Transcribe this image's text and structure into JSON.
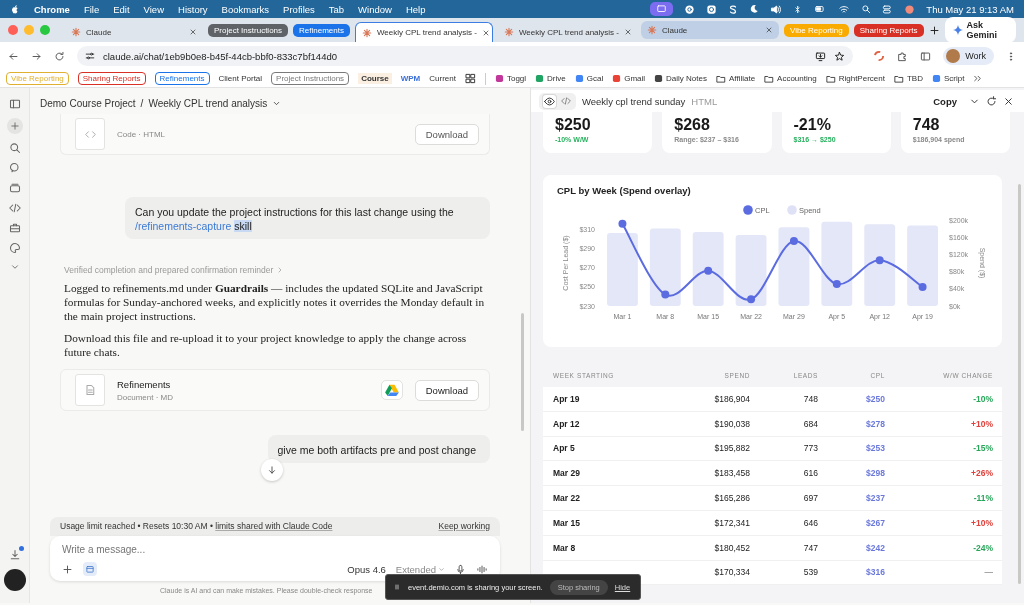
{
  "menu_bar": {
    "app": "Chrome",
    "items": [
      "File",
      "Edit",
      "View",
      "History",
      "Bookmarks",
      "Profiles",
      "Tab",
      "Window",
      "Help"
    ],
    "clock": "Thu May 21  9:13 AM"
  },
  "tabs": [
    {
      "kind": "tab",
      "label": "Claude",
      "selected": false,
      "hovered": false
    },
    {
      "kind": "group",
      "label": "Project Instructions",
      "color": "#5f6368"
    },
    {
      "kind": "group",
      "label": "Refinements",
      "color": "#1a73e8"
    },
    {
      "kind": "tab",
      "label": "Weekly CPL trend analysis -",
      "selected": true,
      "hovered": false
    },
    {
      "kind": "tab",
      "label": "Weekly CPL trend analysis -",
      "selected": false,
      "hovered": false
    },
    {
      "kind": "tab",
      "label": "Claude",
      "selected": false,
      "hovered": true
    },
    {
      "kind": "group",
      "label": "Vibe Reporting",
      "color": "#f9ab00"
    },
    {
      "kind": "group",
      "label": "Sharing Reports",
      "color": "#d93025"
    }
  ],
  "gemini_button": "Ask Gemini",
  "address_bar": {
    "url": "claude.ai/chat/1eb9b0e8-b45f-44cb-bbf0-833c7bf144d0"
  },
  "profile": "Work",
  "bookmarks": [
    {
      "kind": "group",
      "label": "Vibe Reporting",
      "color": "#e0b030"
    },
    {
      "kind": "group",
      "label": "Sharing Reports",
      "color": "#d93025"
    },
    {
      "kind": "group",
      "label": "Refinements",
      "color": "#1a73e8"
    },
    {
      "kind": "text",
      "label": "Client Portal"
    },
    {
      "kind": "group",
      "label": "Project Instructions",
      "color": "#7a7a7a"
    },
    {
      "kind": "text",
      "label": "Course"
    },
    {
      "kind": "text",
      "label": "WPM"
    },
    {
      "kind": "text",
      "label": "Current"
    },
    {
      "kind": "apps"
    },
    {
      "kind": "site",
      "label": "Toggl",
      "color": "#c2379a"
    },
    {
      "kind": "site",
      "label": "Drive",
      "color": "#1fa463"
    },
    {
      "kind": "site",
      "label": "Gcal",
      "color": "#4285f4"
    },
    {
      "kind": "site",
      "label": "Gmail",
      "color": "#ea4335"
    },
    {
      "kind": "site",
      "label": "Daily Notes",
      "color": "#444444"
    },
    {
      "kind": "folder",
      "label": "Affiliate"
    },
    {
      "kind": "folder",
      "label": "Accounting"
    },
    {
      "kind": "folder",
      "label": "RightPercent"
    },
    {
      "kind": "folder",
      "label": "TBD"
    },
    {
      "kind": "site",
      "label": "Script",
      "color": "#4285f4"
    }
  ],
  "chat": {
    "breadcrumb": [
      "Demo Course Project",
      "/",
      "Weekly CPL trend analysis"
    ],
    "artifact_card": {
      "meta": "Code · HTML",
      "button": "Download"
    },
    "messages": [
      {
        "kind": "user",
        "parts": [
          {
            "kind": "text",
            "text": "Can you update the project instructions for this last change using the",
            "highlighted": false
          },
          {
            "kind": "command",
            "text": "/refinements-capture",
            "highlighted": false
          },
          {
            "kind": "text",
            "text": "skill",
            "highlighted": true
          }
        ]
      },
      {
        "kind": "assistant",
        "summary": "Verified completion and prepared confirmation reminder",
        "paragraphs": [
          "Logged to refinements.md under **Guardrails** — includes the updated SQLite and JavaScript formulas for Sunday-anchored weeks, and explicitly notes it overrides the Monday default in the main project instructions.",
          "Download this file and re-upload it to your project knowledge to apply the change across future chats."
        ],
        "file": {
          "title": "Refinements",
          "meta": "Document · MD",
          "button": "Download"
        }
      },
      {
        "kind": "user",
        "parts": [
          {
            "kind": "text",
            "text": "give me both artifacts pre and post change",
            "highlighted": false
          }
        ]
      }
    ],
    "usage": {
      "text": "Usage limit reached • Resets 10:30 AM •",
      "link": "limits shared with Claude Code",
      "action": "Keep working"
    },
    "composer": {
      "placeholder": "Write a message...",
      "model": "Opus 4.6",
      "mode": "Extended"
    },
    "disclaimer": "Claude is AI and can make mistakes. Please double-check response"
  },
  "artifact": {
    "view_toggle": {
      "preview": true
    },
    "title": "Weekly cpl trend sunday",
    "type": "HTML",
    "copy": "Copy",
    "stats": [
      {
        "value": "$250",
        "sub": "-10% W/W",
        "color": "#27b05e"
      },
      {
        "value": "$268",
        "sub": "Range: $237 – $316",
        "color": "#8a8a8a"
      },
      {
        "value": "-21%",
        "sub": "$316 → $250",
        "color": "#27b05e"
      },
      {
        "value": "748",
        "sub": "$186,904 spend",
        "color": "#8a8a8a"
      }
    ],
    "chart_data": {
      "type": "bar",
      "legend": "top",
      "title": "CPL by Week (Spend overlay)",
      "ylabel": "Cost Per Lead ($)",
      "y2label": "Spend ($)",
      "categories": [
        "Mar 1",
        "Mar 8",
        "Mar 15",
        "Mar 22",
        "Mar 29",
        "Apr 5",
        "Apr 12",
        "Apr 19"
      ],
      "series": [
        {
          "name": "CPL",
          "type": "line",
          "marker": "circle",
          "color": "#5b6be0",
          "values": [
            316,
            242,
            267,
            237,
            298,
            253,
            278,
            250
          ]
        },
        {
          "name": "Spend",
          "type": "bar",
          "axis": "y2",
          "color": "#e4e7f8",
          "values": [
            170000,
            180000,
            172000,
            165000,
            183000,
            196000,
            190000,
            187000
          ]
        }
      ],
      "ylim": [
        230,
        320
      ],
      "yticks": [
        {
          "value": 230,
          "label": "$230"
        },
        {
          "value": 250,
          "label": "$250"
        },
        {
          "value": 270,
          "label": "$270"
        },
        {
          "value": 290,
          "label": "$290"
        },
        {
          "value": 310,
          "label": "$310"
        }
      ],
      "y2lim": [
        0,
        200000
      ],
      "y2ticks": [
        {
          "value": 0,
          "label": "$0k"
        },
        {
          "value": 40000,
          "label": "$40k"
        },
        {
          "value": 80000,
          "label": "$80k"
        },
        {
          "value": 120000,
          "label": "$120k"
        },
        {
          "value": 160000,
          "label": "$160k"
        },
        {
          "value": 200000,
          "label": "$200k"
        }
      ]
    },
    "table": {
      "columns": [
        "WEEK STARTING",
        "SPEND",
        "LEADS",
        "CPL",
        "W/W CHANGE"
      ],
      "rows": [
        {
          "week": "Apr 19",
          "spend": "$186,904",
          "leads": "748",
          "cpl": "$250",
          "change": "-10%",
          "color": "#27a65a"
        },
        {
          "week": "Apr 12",
          "spend": "$190,038",
          "leads": "684",
          "cpl": "$278",
          "change": "+10%",
          "color": "#e0413a"
        },
        {
          "week": "Apr 5",
          "spend": "$195,882",
          "leads": "773",
          "cpl": "$253",
          "change": "-15%",
          "color": "#27a65a"
        },
        {
          "week": "Mar 29",
          "spend": "$183,458",
          "leads": "616",
          "cpl": "$298",
          "change": "+26%",
          "color": "#e0413a"
        },
        {
          "week": "Mar 22",
          "spend": "$165,286",
          "leads": "697",
          "cpl": "$237",
          "change": "-11%",
          "color": "#27a65a"
        },
        {
          "week": "Mar 15",
          "spend": "$172,341",
          "leads": "646",
          "cpl": "$267",
          "change": "+10%",
          "color": "#e0413a"
        },
        {
          "week": "Mar 8",
          "spend": "$180,452",
          "leads": "747",
          "cpl": "$242",
          "change": "-24%",
          "color": "#27a65a"
        },
        {
          "spend": "$170,334",
          "leads": "539",
          "cpl": "$316",
          "change": "—",
          "color": "#a0a0a0"
        }
      ]
    }
  },
  "share_banner": {
    "text": "event.demio.com is sharing your screen.",
    "stop": "Stop sharing",
    "hide": "Hide"
  }
}
